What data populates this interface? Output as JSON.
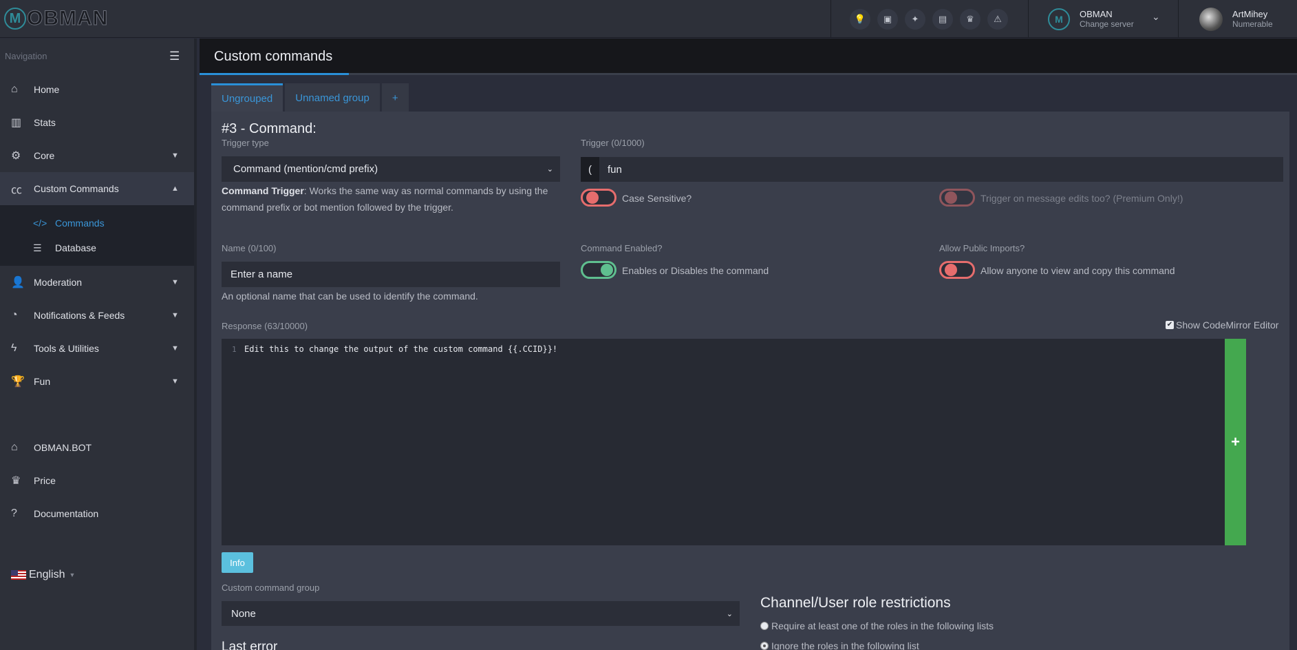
{
  "brand": {
    "logo_text": "OBMAN",
    "logo_letter": "M"
  },
  "header": {
    "server_name": "OBMAN",
    "server_sub": "Change server",
    "user_name": "ArtMihey",
    "user_sub": "Numerable"
  },
  "sidebar": {
    "title": "Navigation",
    "items": [
      {
        "label": "Home",
        "icon": "home-icon"
      },
      {
        "label": "Stats",
        "icon": "chart-icon"
      },
      {
        "label": "Core",
        "icon": "gears-icon"
      },
      {
        "label": "Custom Commands",
        "icon": "cc-icon"
      },
      {
        "label": "Moderation",
        "icon": "user-shield-icon"
      },
      {
        "label": "Notifications & Feeds",
        "icon": "rss-icon"
      },
      {
        "label": "Tools & Utilities",
        "icon": "bolt-icon"
      },
      {
        "label": "Fun",
        "icon": "trophy-icon"
      },
      {
        "label": "OBMAN.BOT",
        "icon": "home-icon"
      },
      {
        "label": "Price",
        "icon": "crown-icon"
      },
      {
        "label": "Documentation",
        "icon": "question-icon"
      }
    ],
    "subitems": [
      {
        "label": "Commands",
        "icon": "code-icon"
      },
      {
        "label": "Database",
        "icon": "database-icon"
      }
    ],
    "language": "English"
  },
  "page": {
    "title": "Custom commands"
  },
  "tabs": [
    "Ungrouped",
    "Unnamed group",
    "+"
  ],
  "command": {
    "heading": "#3 - Command:",
    "trigger_type_label": "Trigger type",
    "trigger_type_value": "Command (mention/cmd prefix)",
    "trigger_help_bold": "Command Trigger",
    "trigger_help": ": Works the same way as normal commands by using the command prefix or bot mention followed by the trigger.",
    "trigger_label": "Trigger (0/1000)",
    "trigger_prefix": "(",
    "trigger_value": "fun",
    "case_sensitive": "Case Sensitive?",
    "trigger_edits": "Trigger on message edits too? (Premium Only!)",
    "name_label": "Name (0/100)",
    "name_placeholder": "Enter a name",
    "name_help": "An optional name that can be used to identify the command.",
    "enabled_label": "Command Enabled?",
    "enabled_text": "Enables or Disables the command",
    "imports_label": "Allow Public Imports?",
    "imports_text": "Allow anyone to view and copy this command",
    "response_label": "Response (63/10000)",
    "show_codemirror": "Show CodeMirror Editor",
    "line_number": "1",
    "response_code": "Edit this to change the output of the custom command {{.CCID}}!",
    "add_button": "+",
    "info_button": "Info",
    "group_label": "Custom command group",
    "group_value": "None",
    "last_error": "Last error",
    "restrictions_title": "Channel/User role restrictions",
    "radio_require": "Require at least one of the roles in the following lists",
    "radio_ignore": "Ignore the roles in the following list"
  }
}
